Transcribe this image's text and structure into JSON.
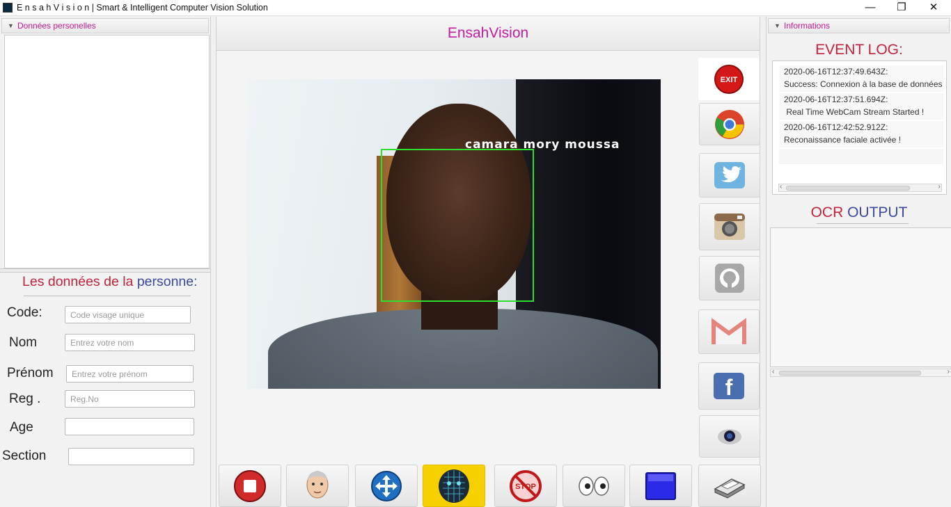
{
  "window": {
    "title": "E n s a h V i s i o n | Smart & Intelligent Computer Vision Solution",
    "minimize": "—",
    "maximize": "❐",
    "close": "✕"
  },
  "left_panel": {
    "header": "Données personelles",
    "form_title_part1": "Les données de la",
    "form_title_part2": "personne:",
    "fields": [
      {
        "label": "Code:",
        "placeholder": "Code visage unique",
        "value": ""
      },
      {
        "label": "Nom",
        "placeholder": "Entrez votre nom",
        "value": ""
      },
      {
        "label": "Prénom",
        "placeholder": "Entrez votre prénom",
        "value": ""
      },
      {
        "label": "Reg .",
        "placeholder": "Reg.No",
        "value": ""
      },
      {
        "label": "Age",
        "placeholder": "",
        "value": ""
      },
      {
        "label": "Section",
        "placeholder": "",
        "value": ""
      }
    ]
  },
  "center": {
    "title": "EnsahVision",
    "recognized_name": "camara mory moussa"
  },
  "side_buttons": {
    "exit_label": "EXIT",
    "items": [
      "exit-icon",
      "chrome-icon",
      "twitter-icon",
      "instagram-icon",
      "github-icon",
      "gmail-icon",
      "facebook-icon",
      "webcam-icon"
    ]
  },
  "toolbar": {
    "stop_sign_label": "STOP",
    "items": [
      "stop-record-icon",
      "face-avatar-icon",
      "move-arrows-icon",
      "face-mesh-icon",
      "stop-sign-icon",
      "eyes-icon",
      "blue-square-icon",
      "scanner-icon"
    ]
  },
  "right_panel": {
    "header": "Informations",
    "event_log_title": "EVENT LOG:",
    "events": [
      {
        "time": "2020-06-16T12:37:49.643Z:",
        "message": "Success: Connexion à la base de données ré"
      },
      {
        "time": "2020-06-16T12:37:51.694Z:",
        "message": " Real Time WebCam Stream Started !"
      },
      {
        "time": "2020-06-16T12:42:52.912Z:",
        "message": "Reconaissance faciale activée !"
      }
    ],
    "ocr_title_part1": "OCR",
    "ocr_title_part2": "OUTPUT",
    "ocr_text": ""
  },
  "colors": {
    "accent_magenta": "#c020a0",
    "title_red": "#c0243c",
    "title_blue": "#3a4aa0",
    "face_box_green": "#2ee02e"
  }
}
